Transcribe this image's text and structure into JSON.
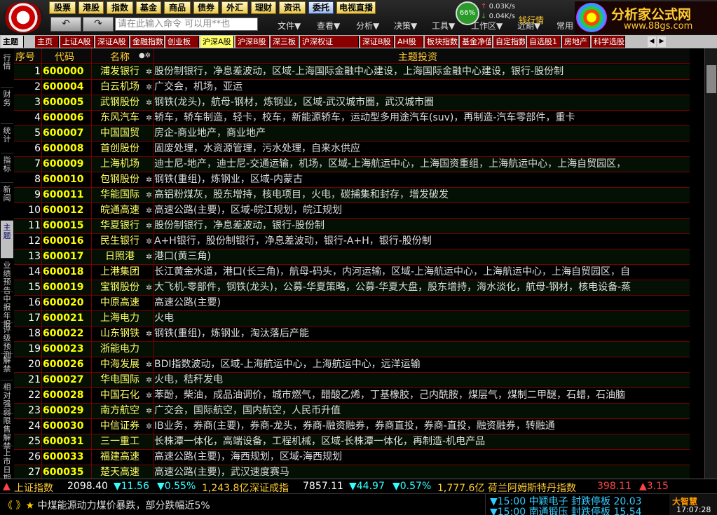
{
  "menu": {
    "buttons": [
      "股票",
      "港股",
      "指数",
      "基金",
      "商品",
      "债券",
      "外汇",
      "理财",
      "资讯",
      "委托",
      "电视直播"
    ],
    "command_placeholder": "请在此输入命令  可以用**也",
    "dropdowns": [
      "文件▼",
      "查看▼",
      "分析▼",
      "决策▼",
      "工具▼",
      "工作区▼",
      "近期▼",
      "常用"
    ],
    "net_percent": "66%",
    "up_speed": "0.03K/s",
    "down_speed": "0.04K/s",
    "partial_brand": "钱行情"
  },
  "brand": {
    "title": "分析家公式网",
    "url": "www.88gs.com"
  },
  "tabs": {
    "head": "主题",
    "items": [
      "主页",
      "上证A股",
      "深证A股",
      "金融指数",
      "创业板",
      "沪深A股",
      "沪深B股",
      "深三板",
      "沪深权证",
      "深证B股",
      "AH股",
      "板块指数",
      "基金净值",
      "自定指数",
      "自选股1",
      "房地产",
      "科学选股"
    ],
    "active": "沪深A股",
    "arrow_left": "◀",
    "arrow_right": "▶"
  },
  "side_tabs": [
    "行情",
    "财务",
    "统计",
    "指标",
    "新闻",
    "主题",
    "业绩预告",
    "中报年报",
    "评级预测",
    "解禁",
    "相对强弱",
    "限售解禁",
    "上市日期"
  ],
  "side_active": "主题",
  "columns": {
    "seq": "序号",
    "code": "代码",
    "name": "名称",
    "flags": "●✲",
    "topic": "主题投资"
  },
  "colors": {
    "code": "#ffff00",
    "name": "#ffff66",
    "header": "#ffcc33",
    "rise": "#ff4444",
    "fall": "#33ffff",
    "row_line": "#770000"
  },
  "rows": [
    {
      "seq": "1",
      "code": "600000",
      "name": "浦发银行",
      "mark": "✲",
      "topic": "股份制银行，净息差波动，区域-上海国际金融中心建设，上海国际金融中心建设，银行-股份制"
    },
    {
      "seq": "2",
      "code": "600004",
      "name": "白云机场",
      "mark": "✲",
      "topic": "广交会，机场，亚运"
    },
    {
      "seq": "3",
      "code": "600005",
      "name": "武钢股份",
      "mark": "✲",
      "topic": "钢铁(龙头)，航母-钢材，炼钢业，区域-武汉城市圈，武汉城市圈"
    },
    {
      "seq": "4",
      "code": "600006",
      "name": "东风汽车",
      "mark": "✲",
      "topic": "轿车，轿车制造，轻卡，校车，新能源轿车，运动型多用途汽车(suv)，再制造-汽车零部件，重卡"
    },
    {
      "seq": "5",
      "code": "600007",
      "name": "中国国贸",
      "mark": "",
      "topic": "房企-商业地产，商业地产"
    },
    {
      "seq": "6",
      "code": "600008",
      "name": "首创股份",
      "mark": "",
      "topic": "固废处理，水资源管理，污水处理，自来水供应"
    },
    {
      "seq": "7",
      "code": "600009",
      "name": "上海机场",
      "mark": "",
      "topic": "迪士尼-地产，迪士尼-交通运输，机场，区域-上海航运中心，上海国资重组，上海航运中心，上海自贸园区，"
    },
    {
      "seq": "8",
      "code": "600010",
      "name": "包钢股份",
      "mark": "✲",
      "topic": "钢铁(重组)，炼钢业，区域-内蒙古"
    },
    {
      "seq": "9",
      "code": "600011",
      "name": "华能国际",
      "mark": "✲",
      "topic": "高铝粉煤灰，股东增持，核电项目，火电，碳捕集和封存，增发破发"
    },
    {
      "seq": "10",
      "code": "600012",
      "name": "皖通高速",
      "mark": "✲",
      "topic": "高速公路(主要)，区域-皖江规划，皖江规划"
    },
    {
      "seq": "11",
      "code": "600015",
      "name": "华夏银行",
      "mark": "✲",
      "topic": "股份制银行，净息差波动，银行-股份制"
    },
    {
      "seq": "12",
      "code": "600016",
      "name": "民生银行",
      "mark": "✲",
      "topic": "A+H银行，股份制银行，净息差波动，银行-A+H，银行-股份制"
    },
    {
      "seq": "13",
      "code": "600017",
      "name": "日照港",
      "mark": "✲",
      "topic": "港口(黄三角)"
    },
    {
      "seq": "14",
      "code": "600018",
      "name": "上港集团",
      "mark": "",
      "topic": "长江黄金水道，港口(长三角)，航母-码头，内河运输，区域-上海航运中心，上海航运中心，上海自贸园区，自"
    },
    {
      "seq": "15",
      "code": "600019",
      "name": "宝钢股份",
      "mark": "✲",
      "topic": "大飞机-零部件，钢铁(龙头)，公募-华夏策略，公募-华夏大盘，股东增持，海水淡化，航母-钢材，核电设备-蒸"
    },
    {
      "seq": "16",
      "code": "600020",
      "name": "中原高速",
      "mark": "",
      "topic": "高速公路(主要)"
    },
    {
      "seq": "17",
      "code": "600021",
      "name": "上海电力",
      "mark": "",
      "topic": "火电"
    },
    {
      "seq": "18",
      "code": "600022",
      "name": "山东钢铁",
      "mark": "✲",
      "topic": "钢铁(重组)，炼钢业，淘汰落后产能"
    },
    {
      "seq": "19",
      "code": "600023",
      "name": "浙能电力",
      "mark": "",
      "topic": ""
    },
    {
      "seq": "20",
      "code": "600026",
      "name": "中海发展",
      "mark": "✲",
      "topic": "BDI指数波动，区域-上海航运中心，上海航运中心，远洋运输"
    },
    {
      "seq": "21",
      "code": "600027",
      "name": "华电国际",
      "mark": "✲",
      "topic": "火电，秸秆发电"
    },
    {
      "seq": "22",
      "code": "600028",
      "name": "中国石化",
      "mark": "✲",
      "topic": "苯酚，柴油，成品油调价，城市燃气，醋酸乙烯，丁基橡胶，己内酰胺，煤层气，煤制二甲醚，石蜡，石油脑"
    },
    {
      "seq": "23",
      "code": "600029",
      "name": "南方航空",
      "mark": "✲",
      "topic": "广交会，国际航空，国内航空，人民币升值"
    },
    {
      "seq": "24",
      "code": "600030",
      "name": "中信证券",
      "mark": "✲",
      "topic": "IB业务，券商(主要)，券商-龙头，券商-融资融券，券商直投，券商-直投，融资融券，转融通"
    },
    {
      "seq": "25",
      "code": "600031",
      "name": "三一重工",
      "mark": "",
      "topic": "长株潭一体化，高端设备，工程机械，区域-长株潭一体化，再制造-机电产品"
    },
    {
      "seq": "26",
      "code": "600033",
      "name": "福建高速",
      "mark": "",
      "topic": "高速公路(主要)，海西规划，区域-海西规划"
    },
    {
      "seq": "27",
      "code": "600035",
      "name": "楚天高速",
      "mark": "",
      "topic": "高速公路(主要)，武汉速度赛马"
    }
  ],
  "status": {
    "sh_name": "上证指数",
    "sh_price": "2098.40",
    "sh_chg": "▼11.56",
    "sh_pct": "▼0.55%",
    "sh_vol": "1,243.8亿",
    "sz_name": "深证成指",
    "sz_price": "7857.11",
    "sz_chg": "▼44.97",
    "sz_pct": "▼0.57%",
    "sz_vol": "1,777.6亿",
    "aex_name": "荷兰阿姆斯特丹指数",
    "aex_price": "398.11",
    "aex_chg": "▲3.15"
  },
  "news": {
    "text": "中煤能源动力煤价暴跌，部分跌幅近5%",
    "arrows": "《 》★"
  },
  "alerts": [
    "▼15:00 中颖电子 封跌停板 20.03",
    "▼15:00 南通锻压 封跌停板 15.54"
  ],
  "corner": {
    "logo": "大智慧",
    "time": "17:07:28"
  }
}
